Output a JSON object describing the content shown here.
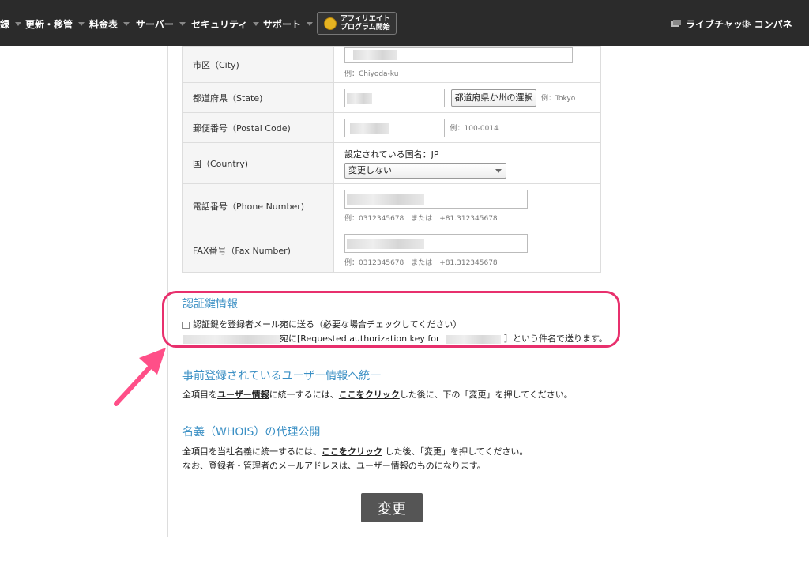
{
  "nav": {
    "items": [
      {
        "label": "録"
      },
      {
        "label": "更新・移管"
      },
      {
        "label": "料金表"
      },
      {
        "label": "サーバー"
      },
      {
        "label": "セキュリティ"
      },
      {
        "label": "サポート"
      }
    ],
    "affiliate_line1": "アフィリエイト",
    "affiliate_line2": "プログラム開始",
    "livechat": "ライブチャット",
    "control_panel": "コンパネ"
  },
  "form": {
    "city": {
      "label": "市区（City)",
      "hint": "例：Chiyoda-ku"
    },
    "state": {
      "label": "都道府県（State)",
      "select": "都道府県か州の選択",
      "hint": "例：Tokyo"
    },
    "postal": {
      "label": "郵便番号（Postal Code)",
      "hint": "例：100-0014"
    },
    "country": {
      "label": "国（Country)",
      "current": "設定されている国名：JP",
      "select": "変更しない"
    },
    "phone": {
      "label": "電話番号（Phone Number)",
      "hint": "例：0312345678　または　+81.312345678"
    },
    "fax": {
      "label": "FAX番号（Fax Number)",
      "hint": "例：0312345678　または　+81.312345678"
    }
  },
  "auth": {
    "title": "認証鍵情報",
    "checkbox_label": "認証鍵を登録者メール宛に送る（必要な場合チェックしてください）",
    "line_prefix": "宛に[Requested authorization key for",
    "line_suffix": "］という件名で送ります。"
  },
  "unify": {
    "title": "事前登録されているユーザー情報へ統一",
    "p1": "全項目を",
    "link1": "ユーザー情報",
    "p2": "に統一するには、",
    "link2": "ここをクリック",
    "p3": "した後に、下の「変更」を押してください。"
  },
  "whois": {
    "title": "名義（WHOIS）の代理公開",
    "p1": "全項目を当社名義に統一するには、",
    "link": "ここをクリック",
    "p2": "した後、「変更」を押してください。",
    "line2": "なお、登録者・管理者のメールアドレスは、ユーザー情報のものになります。"
  },
  "submit_label": "変更",
  "colors": {
    "nav_bg": "#2b2b2b",
    "section_title": "#3a8fc4",
    "highlight": "#e8306d",
    "button": "#555555"
  }
}
